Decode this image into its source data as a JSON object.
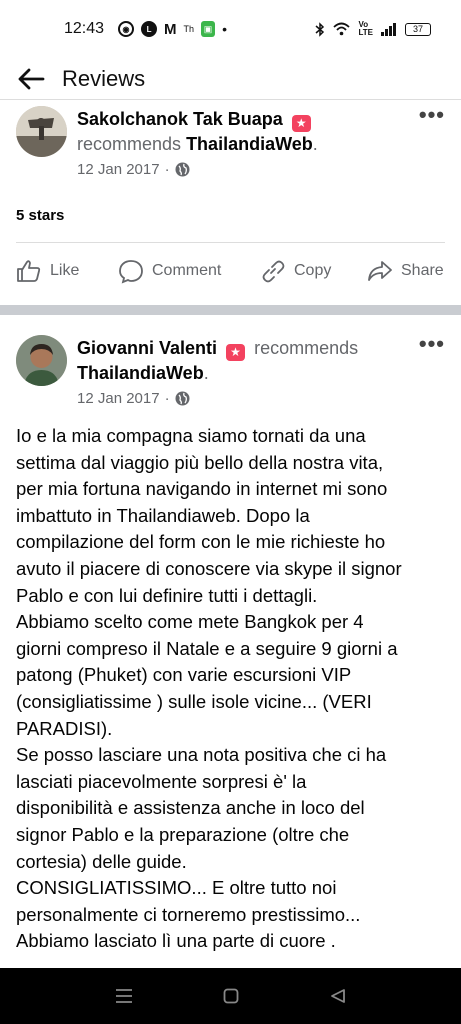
{
  "status_bar": {
    "time": "12:43",
    "icons_left": [
      "dropbox-style-icon",
      "line-icon",
      "gmail-icon",
      "thai-news-icon",
      "green-app-icon",
      "dot"
    ],
    "icons_right": [
      "bluetooth-icon",
      "wifi-icon",
      "volte-icon",
      "signal-icon"
    ],
    "battery": "37"
  },
  "header": {
    "title": "Reviews"
  },
  "reviews": [
    {
      "author": "Sakolchanok Tak Buapa",
      "recommends": "recommends",
      "page": "ThailandiaWeb",
      "date": "12 Jan 2017",
      "rating": "5 stars"
    },
    {
      "author": "Giovanni Valenti",
      "recommends": "recommends",
      "page": "ThailandiaWeb",
      "date": "12 Jan 2017",
      "text": "Io e la mia compagna siamo tornati da una\nsettima dal viaggio più bello della nostra vita,\nper mia fortuna navigando in internet mi sono\nimbattuto in Thailandiaweb. Dopo la\ncompilazione del form con le mie richieste ho\navuto il piacere di conoscere via skype il signor\nPablo e con lui definire tutti i dettagli.\nAbbiamo scelto come mete Bangkok per 4\ngiorni compreso il Natale e a seguire 9 giorni a\npatong (Phuket) con varie escursioni VIP\n(consigliatissime ) sulle isole vicine... (VERI\nPARADISI).\nSe posso lasciare una nota positiva che ci ha\nlasciati piacevolmente sorpresi è' la\ndisponibilità e assistenza anche in loco  del\nsignor Pablo e la preparazione (oltre che\ncortesia) delle guide.\nCONSIGLIATISSIMO... E oltre tutto noi\npersonalmente ci torneremo prestissimo...\nAbbiamo lasciato lì una parte di cuore ."
    }
  ],
  "actions": {
    "like": "Like",
    "comment": "Comment",
    "copy": "Copy",
    "share": "Share"
  },
  "colors": {
    "recommend_badge": "#f3425f",
    "secondary_text": "#65676b",
    "section_divider": "#c9ccd1"
  }
}
